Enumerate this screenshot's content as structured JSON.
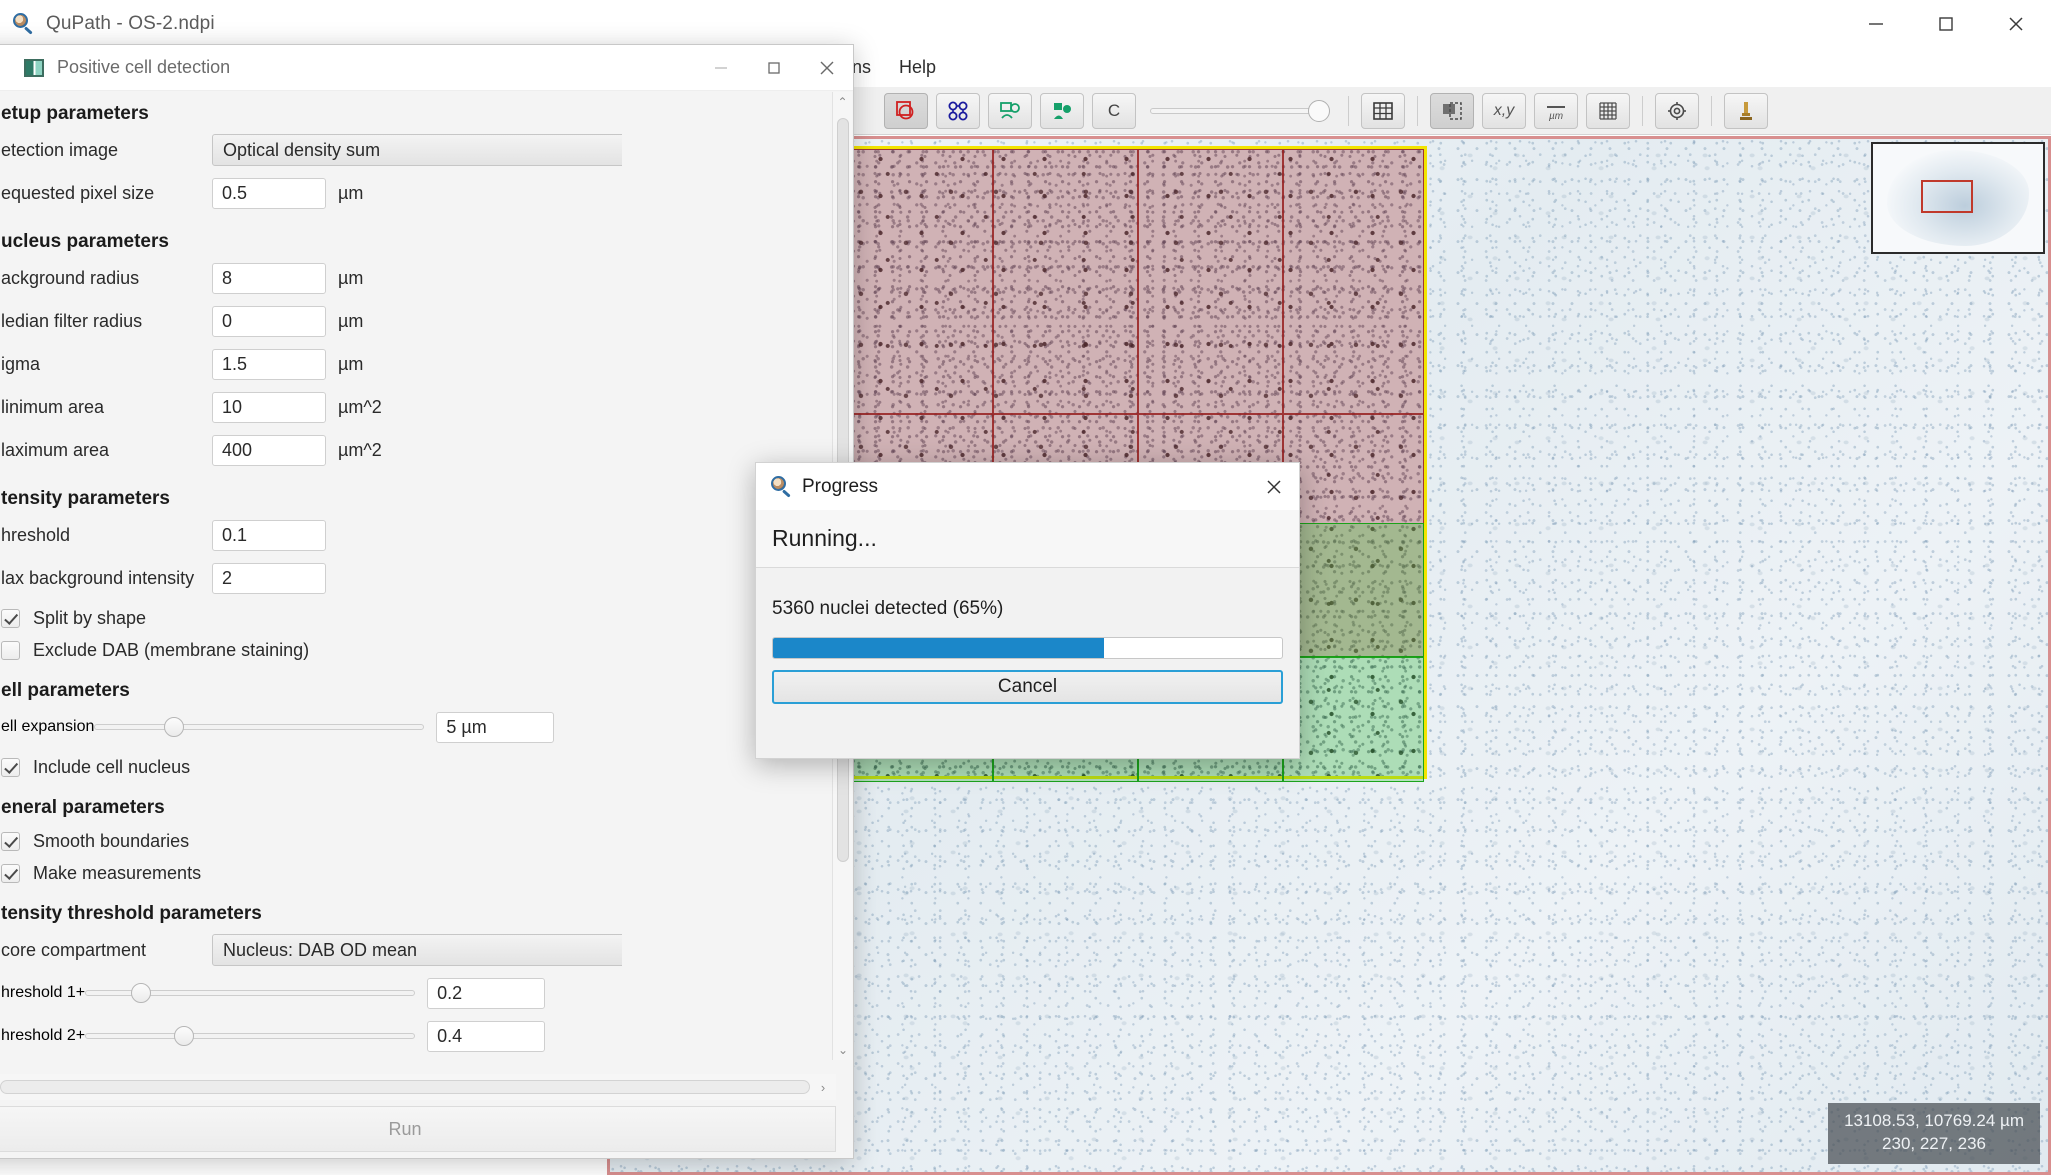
{
  "app": {
    "title": "QuPath - OS-2.ndpi",
    "icon": "qupath-logo-icon",
    "window_controls": [
      {
        "name": "minimize-button",
        "glyph": "minimize-icon"
      },
      {
        "name": "maximize-button",
        "glyph": "maximize-icon"
      },
      {
        "name": "close-button",
        "glyph": "close-icon"
      }
    ],
    "menu": [
      {
        "label": "ons"
      },
      {
        "label": "Help"
      }
    ],
    "toolbar": [
      {
        "name": "brush-annotation-tool",
        "icon": "overlapping-circles-icon",
        "pressed": true
      },
      {
        "name": "points-tool",
        "icon": "four-circles-icon",
        "pressed": false
      },
      {
        "name": "show-annotations-toggle",
        "icon": "square-circle-outline-icon",
        "pressed": false
      },
      {
        "name": "fill-annotations-toggle",
        "icon": "square-circle-filled-icon",
        "pressed": false
      },
      {
        "name": "show-classification-toggle",
        "icon": "letter-c-icon",
        "pressed": false
      },
      {
        "name": "opacity-slider",
        "icon": "slider",
        "value": 100
      },
      {
        "name": "show-measurements-table",
        "icon": "table-grid-icon",
        "pressed": false
      },
      {
        "name": "show-overview-toggle",
        "icon": "overview-thumbnail-icon",
        "pressed": true
      },
      {
        "name": "show-location-toggle",
        "icon": "xy-coordinates-icon",
        "pressed": false
      },
      {
        "name": "show-scalebar-toggle",
        "icon": "micrometer-scalebar-icon",
        "pressed": false
      },
      {
        "name": "show-grid-toggle",
        "icon": "grid-icon",
        "pressed": false
      },
      {
        "name": "preferences-button",
        "icon": "gear-icon",
        "pressed": false
      },
      {
        "name": "brightness-contrast-button",
        "icon": "microscope-icon",
        "pressed": false
      }
    ]
  },
  "viewer": {
    "status_line1": "13108.53, 10769.24 µm",
    "status_line2": "230, 227, 236",
    "colors": {
      "annotation_outline": "#f2e400",
      "tile_negative": "#b44646",
      "tile_positive": "#3cc83c",
      "viewer_border": "#d88f8f",
      "thumbnail_viewport": "#c0392b"
    }
  },
  "detection_dialog": {
    "title": "Positive cell detection",
    "icon": "image-swatch-icon",
    "controls": [
      {
        "name": "minimize-button",
        "glyph": "minimize-icon"
      },
      {
        "name": "maximize-button",
        "glyph": "maximize-icon"
      },
      {
        "name": "close-button",
        "glyph": "close-icon"
      }
    ],
    "sections": [
      {
        "heading": "etup parameters",
        "rows": [
          {
            "kind": "combo",
            "label": "etection image",
            "value": "Optical density sum"
          },
          {
            "kind": "text",
            "label": "equested pixel size",
            "value": "0.5",
            "unit": "µm"
          }
        ]
      },
      {
        "heading": "ucleus parameters",
        "rows": [
          {
            "kind": "text",
            "label": "ackground radius",
            "value": "8",
            "unit": "µm"
          },
          {
            "kind": "text",
            "label": "ledian filter radius",
            "value": "0",
            "unit": "µm"
          },
          {
            "kind": "text",
            "label": "igma",
            "value": "1.5",
            "unit": "µm"
          },
          {
            "kind": "text",
            "label": "linimum area",
            "value": "10",
            "unit": "µm^2"
          },
          {
            "kind": "text",
            "label": "laximum area",
            "value": "400",
            "unit": "µm^2"
          }
        ]
      },
      {
        "heading": "tensity parameters",
        "rows": [
          {
            "kind": "text",
            "label": "hreshold",
            "value": "0.1",
            "unit": ""
          },
          {
            "kind": "text",
            "label": "lax background intensity",
            "value": "2",
            "unit": ""
          },
          {
            "kind": "check",
            "label": "Split by shape",
            "checked": true
          },
          {
            "kind": "check",
            "label": "Exclude DAB (membrane staining)",
            "checked": false
          }
        ]
      },
      {
        "heading": "ell parameters",
        "rows": [
          {
            "kind": "slider",
            "label": "ell expansion",
            "value": "5 µm",
            "pos": 21
          },
          {
            "kind": "check",
            "label": "Include cell nucleus",
            "checked": true
          }
        ]
      },
      {
        "heading": "eneral parameters",
        "rows": [
          {
            "kind": "check",
            "label": "Smooth boundaries",
            "checked": true
          },
          {
            "kind": "check",
            "label": "Make measurements",
            "checked": true
          }
        ]
      },
      {
        "heading": "tensity threshold parameters",
        "rows": [
          {
            "kind": "combo",
            "label": "core compartment",
            "value": "Nucleus: DAB OD mean"
          },
          {
            "kind": "slider",
            "label": "hreshold 1+",
            "value": "0.2",
            "pos": 14
          },
          {
            "kind": "slider",
            "label": "hreshold 2+",
            "value": "0.4",
            "pos": 27
          }
        ]
      }
    ],
    "run_label": "Run",
    "scroll_left_glyph": "‹",
    "scroll_right_glyph": "›"
  },
  "progress_dialog": {
    "title": "Progress",
    "icon": "qupath-logo-icon",
    "close_glyph": "close-icon",
    "heading": "Running...",
    "message": "5360 nuclei detected (65%)",
    "percent": 65,
    "cancel_label": "Cancel",
    "bar_color": "#1b87c9",
    "accent_color": "#2a9fd6"
  }
}
